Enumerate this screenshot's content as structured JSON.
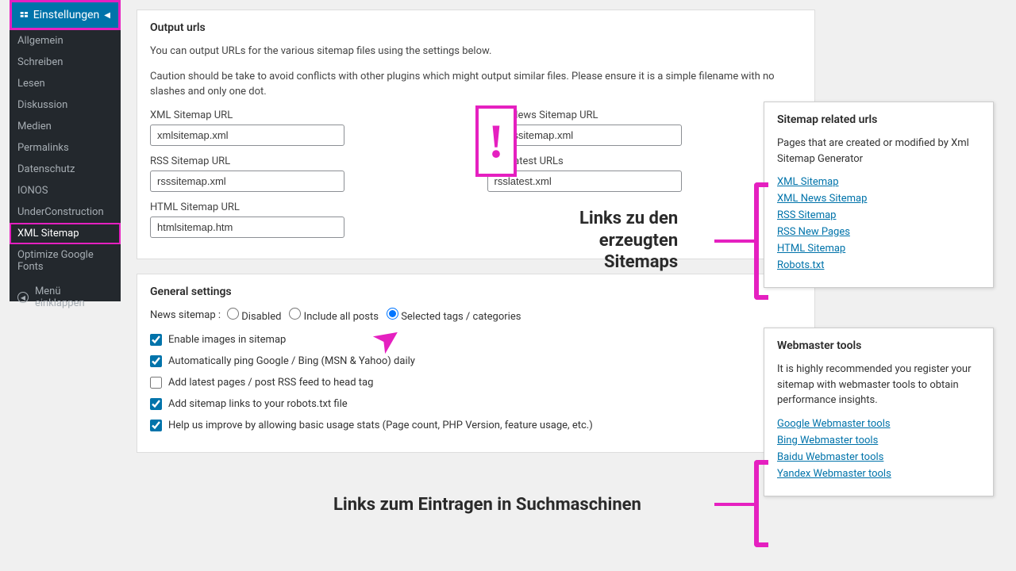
{
  "sidebar": {
    "header": "Einstellungen",
    "items": [
      "Allgemein",
      "Schreiben",
      "Lesen",
      "Diskussion",
      "Medien",
      "Permalinks",
      "Datenschutz",
      "IONOS",
      "UnderConstruction",
      "XML Sitemap",
      "Optimize Google Fonts"
    ],
    "activeIndex": 9,
    "collapse": "Menü einklappen"
  },
  "output": {
    "heading": "Output urls",
    "desc1": "You can output URLs for the various sitemap files using the settings below.",
    "desc2": "Caution should be take to avoid conflicts with other plugins which might output similar files. Please ensure it is a simple filename with no slashes and only one dot.",
    "fields": {
      "xml_label": "XML Sitemap URL",
      "xml_value": "xmlsitemap.xml",
      "news_label": "XML News Sitemap URL",
      "news_value": "newssitemap.xml",
      "rss_label": "RSS Sitemap URL",
      "rss_value": "rsssitemap.xml",
      "rsslatest_label": "RSS Latest URLs",
      "rsslatest_value": "rsslatest.xml",
      "html_label": "HTML Sitemap URL",
      "html_value": "htmlsitemap.htm"
    }
  },
  "general": {
    "heading": "General settings",
    "news_label": "News sitemap :",
    "news_options": [
      "Disabled",
      "Include all posts",
      "Selected tags / categories"
    ],
    "news_selected": 2,
    "checks": [
      {
        "label": "Enable images in sitemap",
        "checked": true
      },
      {
        "label": "Automatically ping Google / Bing (MSN & Yahoo) daily",
        "checked": true
      },
      {
        "label": "Add latest pages / post RSS feed to head tag",
        "checked": false
      },
      {
        "label": "Add sitemap links to your robots.txt file",
        "checked": true
      },
      {
        "label": "Help us improve by allowing basic usage stats (Page count, PHP Version, feature usage, etc.)",
        "checked": true
      }
    ]
  },
  "related": {
    "heading": "Sitemap related urls",
    "desc": "Pages that are created or modified by Xml Sitemap Generator",
    "links": [
      "XML Sitemap",
      "XML News Sitemap",
      "RSS Sitemap",
      "RSS New Pages",
      "HTML Sitemap",
      "Robots.txt"
    ]
  },
  "webmaster": {
    "heading": "Webmaster tools",
    "desc": "It is highly recommended you register your sitemap with webmaster tools to obtain performance insights.",
    "links": [
      "Google Webmaster tools",
      "Bing Webmaster tools",
      "Baidu Webmaster tools",
      "Yandex Webmaster tools"
    ]
  },
  "annot": {
    "text1": "Links zu den\nerzeugten\nSitemaps",
    "text2": "Links zum Eintragen in Suchmaschinen"
  }
}
